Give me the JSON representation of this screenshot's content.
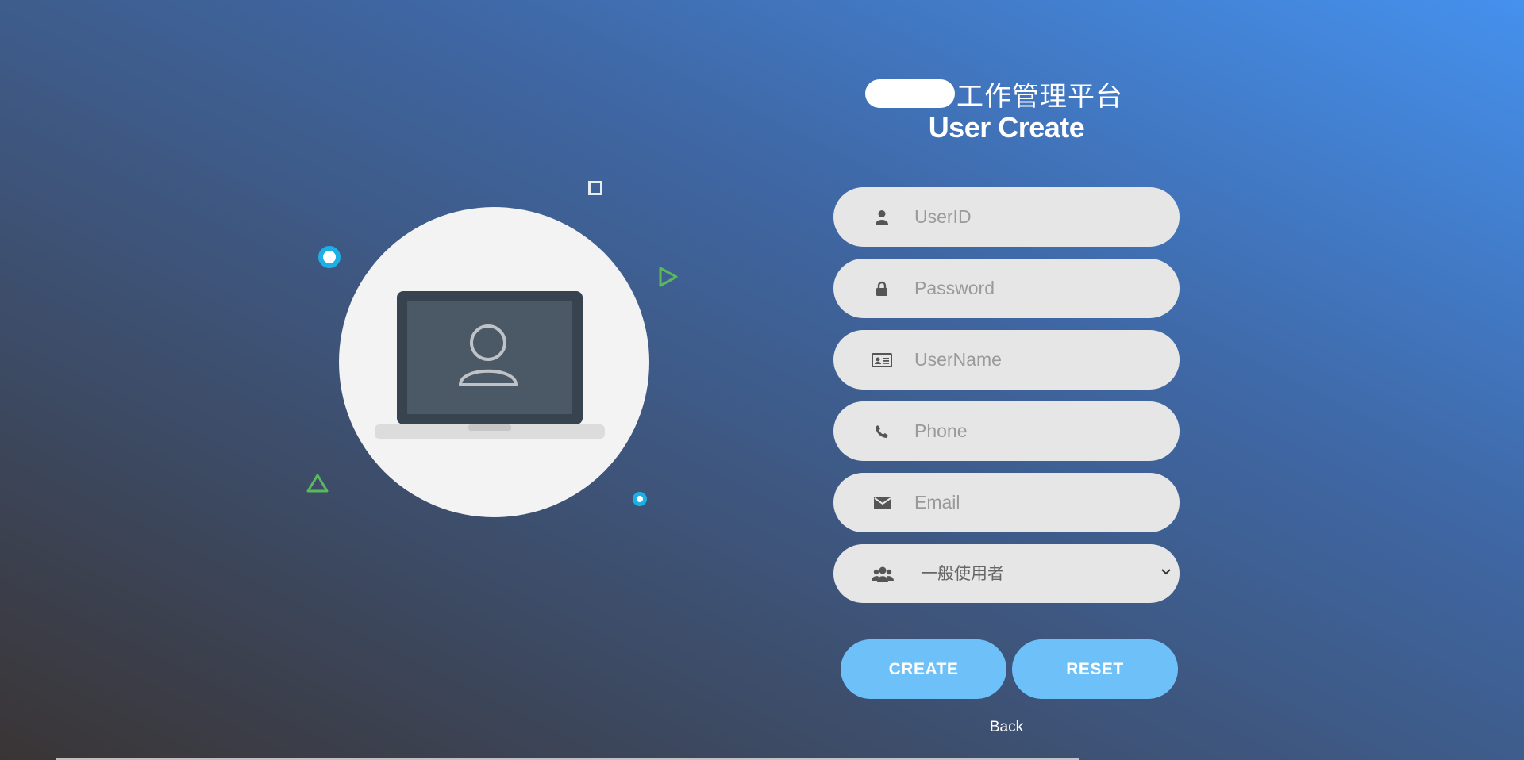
{
  "header": {
    "title_cn": "工作管理平台",
    "title_en": "User Create"
  },
  "form": {
    "fields": [
      {
        "name": "userid",
        "placeholder": "UserID",
        "icon": "user-icon"
      },
      {
        "name": "password",
        "placeholder": "Password",
        "icon": "lock-icon"
      },
      {
        "name": "username",
        "placeholder": "UserName",
        "icon": "id-card-icon"
      },
      {
        "name": "phone",
        "placeholder": "Phone",
        "icon": "phone-icon"
      },
      {
        "name": "email",
        "placeholder": "Email",
        "icon": "envelope-icon"
      }
    ],
    "role_select": {
      "value": "一般使用者",
      "icon": "users-icon"
    },
    "create_label": "CREATE",
    "reset_label": "RESET",
    "back_label": "Back"
  },
  "colors": {
    "button": "#6ec1f8",
    "field_bg": "#e6e6e6",
    "accent_ring": "#1db0e6",
    "accent_green": "#5cb85c"
  }
}
